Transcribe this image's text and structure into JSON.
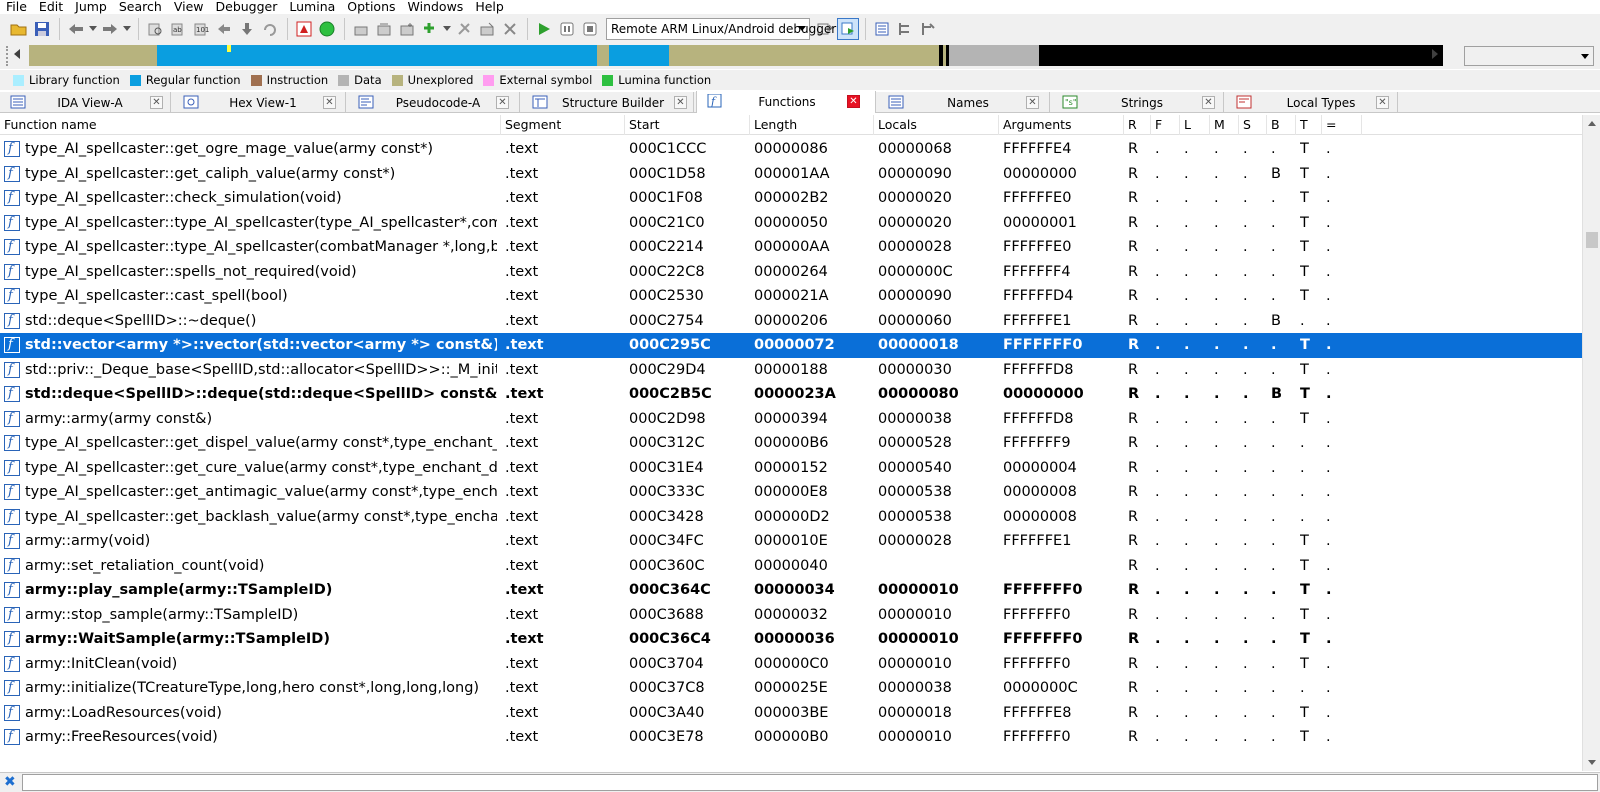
{
  "menu": [
    "File",
    "Edit",
    "Jump",
    "Search",
    "View",
    "Debugger",
    "Lumina",
    "Options",
    "Windows",
    "Help"
  ],
  "toolbar": {
    "debugger_select": "Remote ARM Linux/Android debugger"
  },
  "navband": {
    "colors": {
      "regular": "#0a9ee0",
      "unexplored": "#b7b37e",
      "data": "#b4b4b4",
      "black": "#000000"
    }
  },
  "legend": [
    {
      "label": "Library function",
      "color": "#aaeeff"
    },
    {
      "label": "Regular function",
      "color": "#0a9ee0"
    },
    {
      "label": "Instruction",
      "color": "#a07050"
    },
    {
      "label": "Data",
      "color": "#b4b4b4"
    },
    {
      "label": "Unexplored",
      "color": "#b7b37e"
    },
    {
      "label": "External symbol",
      "color": "#ff9cf0"
    },
    {
      "label": "Lumina function",
      "color": "#2ec040"
    }
  ],
  "tabs": [
    {
      "label": "IDA View-A",
      "icon": "ida-view-icon"
    },
    {
      "label": "Hex View-1",
      "icon": "hex-view-icon"
    },
    {
      "label": "Pseudocode-A",
      "icon": "pseudocode-icon"
    },
    {
      "label": "Structure Builder",
      "icon": "structure-builder-icon"
    },
    {
      "label": "Functions",
      "icon": "functions-icon"
    },
    {
      "label": "Names",
      "icon": "names-icon"
    },
    {
      "label": "Strings",
      "icon": "strings-icon"
    },
    {
      "label": "Local Types",
      "icon": "local-types-icon"
    }
  ],
  "columns": [
    "Function name",
    "Segment",
    "Start",
    "Length",
    "Locals",
    "Arguments",
    "R",
    "F",
    "L",
    "M",
    "S",
    "B",
    "T",
    "="
  ],
  "rows": [
    {
      "name": "type_AI_spellcaster::get_ogre_mage_value(army const*)",
      "segment": ".text",
      "start": "000C1CCC",
      "length": "00000086",
      "locals": "00000068",
      "args": "FFFFFFE4",
      "flags": [
        "R",
        ".",
        ".",
        ".",
        ".",
        ".",
        "T",
        "."
      ],
      "style": "normal"
    },
    {
      "name": "type_AI_spellcaster::get_caliph_value(army const*)",
      "segment": ".text",
      "start": "000C1D58",
      "length": "000001AA",
      "locals": "00000090",
      "args": "00000000",
      "flags": [
        "R",
        ".",
        ".",
        ".",
        ".",
        "B",
        "T",
        "."
      ],
      "style": "normal"
    },
    {
      "name": "type_AI_spellcaster::check_simulation(void)",
      "segment": ".text",
      "start": "000C1F08",
      "length": "000002B2",
      "locals": "00000020",
      "args": "FFFFFFE0",
      "flags": [
        "R",
        ".",
        ".",
        ".",
        ".",
        ".",
        "T",
        "."
      ],
      "style": "normal"
    },
    {
      "name": "type_AI_spellcaster::type_AI_spellcaster(type_AI_spellcaster*,combat…",
      "segment": ".text",
      "start": "000C21C0",
      "length": "00000050",
      "locals": "00000020",
      "args": "00000001",
      "flags": [
        "R",
        ".",
        ".",
        ".",
        ".",
        ".",
        "T",
        "."
      ],
      "style": "normal"
    },
    {
      "name": "type_AI_spellcaster::type_AI_spellcaster(combatManager *,long,bool)",
      "segment": ".text",
      "start": "000C2214",
      "length": "000000AA",
      "locals": "00000028",
      "args": "FFFFFFE0",
      "flags": [
        "R",
        ".",
        ".",
        ".",
        ".",
        ".",
        "T",
        "."
      ],
      "style": "normal"
    },
    {
      "name": "type_AI_spellcaster::spells_not_required(void)",
      "segment": ".text",
      "start": "000C22C8",
      "length": "00000264",
      "locals": "0000000C",
      "args": "FFFFFFF4",
      "flags": [
        "R",
        ".",
        ".",
        ".",
        ".",
        ".",
        "T",
        "."
      ],
      "style": "normal"
    },
    {
      "name": "type_AI_spellcaster::cast_spell(bool)",
      "segment": ".text",
      "start": "000C2530",
      "length": "0000021A",
      "locals": "00000090",
      "args": "FFFFFFD4",
      "flags": [
        "R",
        ".",
        ".",
        ".",
        ".",
        ".",
        "T",
        "."
      ],
      "style": "normal"
    },
    {
      "name": "std::deque<SpellID>::~deque()",
      "segment": ".text",
      "start": "000C2754",
      "length": "00000206",
      "locals": "00000060",
      "args": "FFFFFFE1",
      "flags": [
        "R",
        ".",
        ".",
        ".",
        ".",
        "B",
        ".",
        "."
      ],
      "style": "normal"
    },
    {
      "name": "std::vector<army *>::vector(std::vector<army *> const&)",
      "segment": ".text",
      "start": "000C295C",
      "length": "00000072",
      "locals": "00000018",
      "args": "FFFFFFF0",
      "flags": [
        "R",
        ".",
        ".",
        ".",
        ".",
        ".",
        "T",
        "."
      ],
      "style": "selected"
    },
    {
      "name": "std::priv::_Deque_base<SpellID,std::allocator<SpellID>>::_M_initializ…",
      "segment": ".text",
      "start": "000C29D4",
      "length": "00000188",
      "locals": "00000030",
      "args": "FFFFFFD8",
      "flags": [
        "R",
        ".",
        ".",
        ".",
        ".",
        ".",
        "T",
        "."
      ],
      "style": "normal"
    },
    {
      "name": "std::deque<SpellID>::deque(std::deque<SpellID> const&)",
      "segment": ".text",
      "start": "000C2B5C",
      "length": "0000023A",
      "locals": "00000080",
      "args": "00000000",
      "flags": [
        "R",
        ".",
        ".",
        ".",
        ".",
        "B",
        "T",
        "."
      ],
      "style": "bold"
    },
    {
      "name": "army::army(army const&)",
      "segment": ".text",
      "start": "000C2D98",
      "length": "00000394",
      "locals": "00000038",
      "args": "FFFFFFD8",
      "flags": [
        "R",
        ".",
        ".",
        ".",
        ".",
        ".",
        "T",
        "."
      ],
      "style": "normal"
    },
    {
      "name": "type_AI_spellcaster::get_dispel_value(army const*,type_enchant_data)",
      "segment": ".text",
      "start": "000C312C",
      "length": "000000B6",
      "locals": "00000528",
      "args": "FFFFFFF9",
      "flags": [
        "R",
        ".",
        ".",
        ".",
        ".",
        ".",
        ".",
        "."
      ],
      "style": "normal"
    },
    {
      "name": "type_AI_spellcaster::get_cure_value(army const*,type_enchant_data)",
      "segment": ".text",
      "start": "000C31E4",
      "length": "00000152",
      "locals": "00000540",
      "args": "00000004",
      "flags": [
        "R",
        ".",
        ".",
        ".",
        ".",
        ".",
        ".",
        "."
      ],
      "style": "normal"
    },
    {
      "name": "type_AI_spellcaster::get_antimagic_value(army const*,type_enchant_…",
      "segment": ".text",
      "start": "000C333C",
      "length": "000000E8",
      "locals": "00000538",
      "args": "00000008",
      "flags": [
        "R",
        ".",
        ".",
        ".",
        ".",
        ".",
        ".",
        "."
      ],
      "style": "normal"
    },
    {
      "name": "type_AI_spellcaster::get_backlash_value(army const*,type_enchant_d…",
      "segment": ".text",
      "start": "000C3428",
      "length": "000000D2",
      "locals": "00000538",
      "args": "00000008",
      "flags": [
        "R",
        ".",
        ".",
        ".",
        ".",
        ".",
        ".",
        "."
      ],
      "style": "normal"
    },
    {
      "name": "army::army(void)",
      "segment": ".text",
      "start": "000C34FC",
      "length": "0000010E",
      "locals": "00000028",
      "args": "FFFFFFE1",
      "flags": [
        "R",
        ".",
        ".",
        ".",
        ".",
        ".",
        "T",
        "."
      ],
      "style": "normal"
    },
    {
      "name": "army::set_retaliation_count(void)",
      "segment": ".text",
      "start": "000C360C",
      "length": "00000040",
      "locals": "",
      "args": "",
      "flags": [
        "R",
        ".",
        ".",
        ".",
        ".",
        ".",
        "T",
        "."
      ],
      "style": "normal"
    },
    {
      "name": "army::play_sample(army::TSampleID)",
      "segment": ".text",
      "start": "000C364C",
      "length": "00000034",
      "locals": "00000010",
      "args": "FFFFFFF0",
      "flags": [
        "R",
        ".",
        ".",
        ".",
        ".",
        ".",
        "T",
        "."
      ],
      "style": "bold"
    },
    {
      "name": "army::stop_sample(army::TSampleID)",
      "segment": ".text",
      "start": "000C3688",
      "length": "00000032",
      "locals": "00000010",
      "args": "FFFFFFF0",
      "flags": [
        "R",
        ".",
        ".",
        ".",
        ".",
        ".",
        "T",
        "."
      ],
      "style": "normal"
    },
    {
      "name": "army::WaitSample(army::TSampleID)",
      "segment": ".text",
      "start": "000C36C4",
      "length": "00000036",
      "locals": "00000010",
      "args": "FFFFFFF0",
      "flags": [
        "R",
        ".",
        ".",
        ".",
        ".",
        ".",
        "T",
        "."
      ],
      "style": "bold"
    },
    {
      "name": "army::InitClean(void)",
      "segment": ".text",
      "start": "000C3704",
      "length": "000000C0",
      "locals": "00000010",
      "args": "FFFFFFF0",
      "flags": [
        "R",
        ".",
        ".",
        ".",
        ".",
        ".",
        "T",
        "."
      ],
      "style": "normal"
    },
    {
      "name": "army::initialize(TCreatureType,long,hero const*,long,long,long)",
      "segment": ".text",
      "start": "000C37C8",
      "length": "0000025E",
      "locals": "00000038",
      "args": "0000000C",
      "flags": [
        "R",
        ".",
        ".",
        ".",
        ".",
        ".",
        ".",
        "."
      ],
      "style": "normal"
    },
    {
      "name": "army::LoadResources(void)",
      "segment": ".text",
      "start": "000C3A40",
      "length": "000003BE",
      "locals": "00000018",
      "args": "FFFFFFE8",
      "flags": [
        "R",
        ".",
        ".",
        ".",
        ".",
        ".",
        "T",
        "."
      ],
      "style": "normal"
    },
    {
      "name": "army::FreeResources(void)",
      "segment": ".text",
      "start": "000C3E78",
      "length": "000000B0",
      "locals": "00000010",
      "args": "FFFFFFF0",
      "flags": [
        "R",
        ".",
        ".",
        ".",
        ".",
        ".",
        "T",
        "."
      ],
      "style": "normal"
    }
  ],
  "command": {
    "value": ""
  }
}
